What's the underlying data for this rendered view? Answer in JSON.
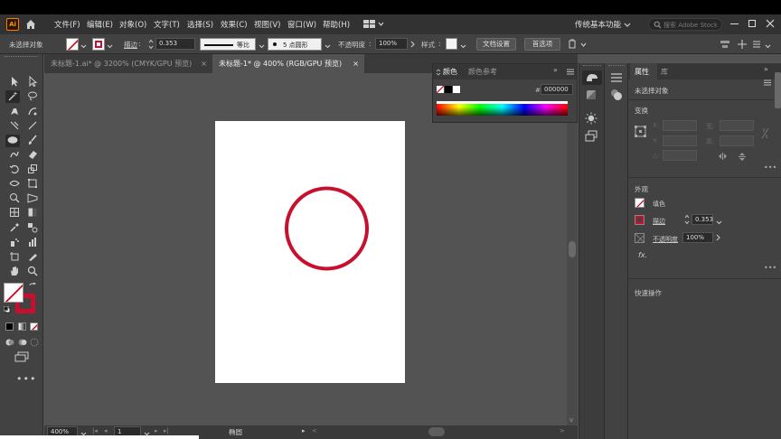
{
  "menu": {
    "logo": "Ai",
    "items": [
      "文件(F)",
      "编辑(E)",
      "对象(O)",
      "文字(T)",
      "选择(S)",
      "效果(C)",
      "视图(V)",
      "窗口(W)",
      "帮助(H)"
    ],
    "workspace": "传统基本功能",
    "search_placeholder": "搜索 Adobe Stock"
  },
  "control": {
    "selection": "未选择对象",
    "stroke_label": "描边",
    "stroke_value": "0.353",
    "stroke_profile": "等比",
    "brush": "5 点圆形",
    "opacity_label": "不透明度",
    "opacity_value": "100%",
    "style_label": "样式",
    "doc_setup": "文档设置",
    "preferences": "首选项"
  },
  "tabs": [
    {
      "label": "未标题-1.ai* @ 3200% (CMYK/GPU 预览)",
      "close": "×"
    },
    {
      "label": "未标题-1* @ 400% (RGB/GPU 预览)",
      "close": "×"
    }
  ],
  "color_panel": {
    "tab_color": "颜色",
    "tab_guide": "颜色参考",
    "hex_prefix": "#",
    "hex": "000000"
  },
  "status": {
    "zoom": "400%",
    "page": "1",
    "tool": "椭圆"
  },
  "properties": {
    "tab_properties": "属性",
    "tab_library": "库",
    "selection": "未选择对象",
    "transform": "变换",
    "x_label": "X:",
    "y_label": "Y:",
    "w_label": "宽:",
    "h_label": "高:",
    "angle_label": "△:",
    "appearance": "外观",
    "fill_label": "填色",
    "stroke_label": "描边",
    "stroke_value": "0.353",
    "opacity_label": "不透明度",
    "opacity_value": "100%",
    "fx": "fx.",
    "quick_actions": "快速操作"
  },
  "colors": {
    "stroke_red": "#c8102e",
    "ui_dark": "#323232",
    "ui_mid": "#424242",
    "canvas": "#535353"
  }
}
